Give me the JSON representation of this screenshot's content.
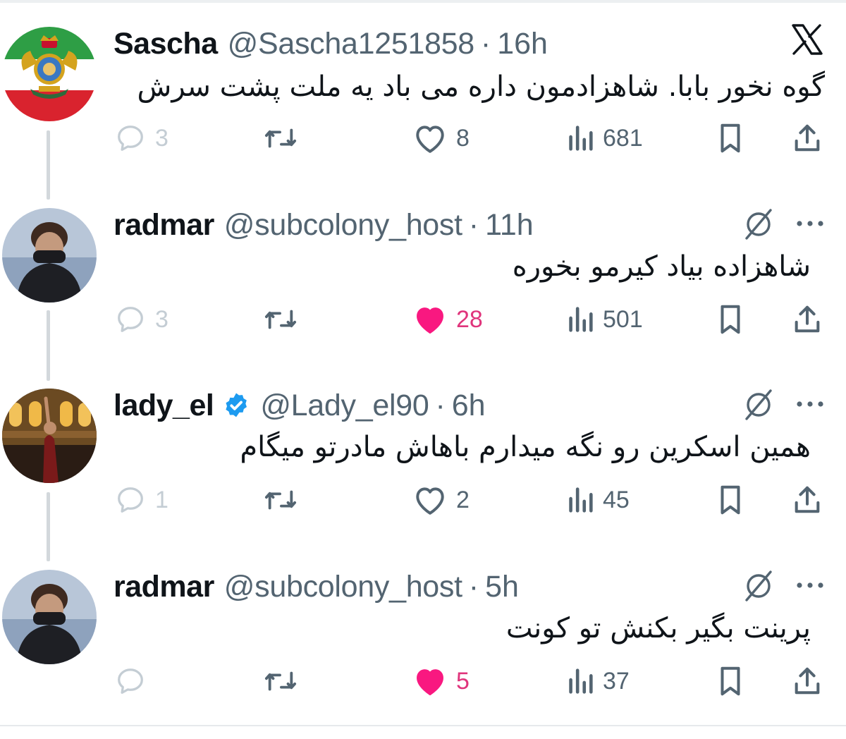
{
  "tweets": [
    {
      "name": "Sascha",
      "handle": "@Sascha1251858",
      "separator": "·",
      "time": "16h",
      "verified": false,
      "text": "گوه نخور بابا. شاهزادمون داره می باد یه ملت پشت سرش",
      "replies": "3",
      "likes": "8",
      "liked": false,
      "views": "681",
      "corner_icon": "x-logo-icon"
    },
    {
      "name": "radmar",
      "handle": "@subcolony_host",
      "separator": "·",
      "time": "11h",
      "verified": false,
      "text": "شاهزاده بیاد کیرمو بخوره",
      "replies": "3",
      "likes": "28",
      "liked": true,
      "views": "501",
      "corner_icon": "grok-icon"
    },
    {
      "name": "lady_el",
      "handle": "@Lady_el90",
      "separator": "·",
      "time": "6h",
      "verified": true,
      "text": "همین اسکرین رو نگه میدارم باهاش مادرتو میگام",
      "replies": "1",
      "likes": "2",
      "liked": false,
      "views": "45",
      "corner_icon": "grok-icon"
    },
    {
      "name": "radmar",
      "handle": "@subcolony_host",
      "separator": "·",
      "time": "5h",
      "verified": false,
      "text": "پرینت بگیر بکنش تو کونت",
      "replies": "",
      "likes": "5",
      "liked": true,
      "views": "37",
      "corner_icon": "grok-icon"
    }
  ],
  "colors": {
    "text": "#0f1419",
    "muted": "#536471",
    "faint": "#c4cdd4",
    "like_pink": "#f91880",
    "verified_blue": "#1d9bf0",
    "thread_line": "#d3d8dc"
  }
}
